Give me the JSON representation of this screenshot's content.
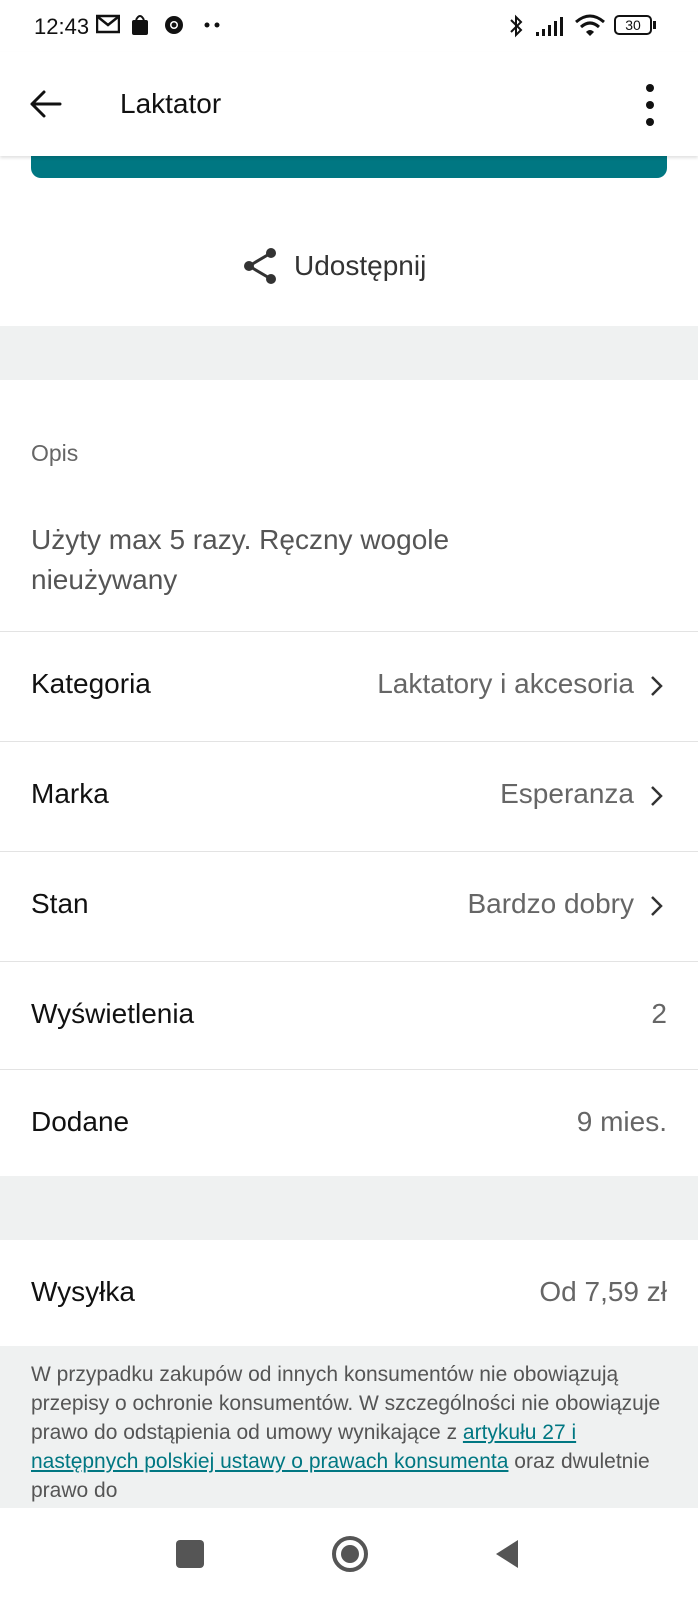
{
  "status_bar": {
    "time": "12:43",
    "battery": "30",
    "icons": [
      "mail-icon",
      "bag-icon",
      "chrome-icon",
      "more-dots-icon",
      "bluetooth-icon",
      "signal-icon",
      "wifi-icon",
      "battery-icon"
    ]
  },
  "app_bar": {
    "title": "Laktator",
    "back_icon": "arrow-left-icon",
    "menu_icon": "more-vertical-icon"
  },
  "share": {
    "label": "Udostępnij",
    "icon": "share-icon"
  },
  "description": {
    "label": "Opis",
    "text": "Użyty max 5 razy. Ręczny wogole nieużywany"
  },
  "details": {
    "category": {
      "label": "Kategoria",
      "value": "Laktatory i akcesoria"
    },
    "brand": {
      "label": "Marka",
      "value": "Esperanza"
    },
    "condition": {
      "label": "Stan",
      "value": "Bardzo dobry"
    },
    "views": {
      "label": "Wyświetlenia",
      "value": "2"
    },
    "added": {
      "label": "Dodane",
      "value": "9 mies."
    }
  },
  "shipping": {
    "label": "Wysyłka",
    "value": "Od 7,59 zł"
  },
  "notice": {
    "text_1": "W przypadku zakupów od innych konsumentów nie obowiązują przepisy o ochronie konsumentów. W szczególności nie obowiązuje prawo do odstąpienia od umowy wynikające z ",
    "link": "artykułu 27 i następnych polskiej ustawy o prawach konsumenta",
    "text_2": " oraz dwuletnie prawo do"
  },
  "colors": {
    "accent": "#007782",
    "band": "#eff1f1"
  }
}
